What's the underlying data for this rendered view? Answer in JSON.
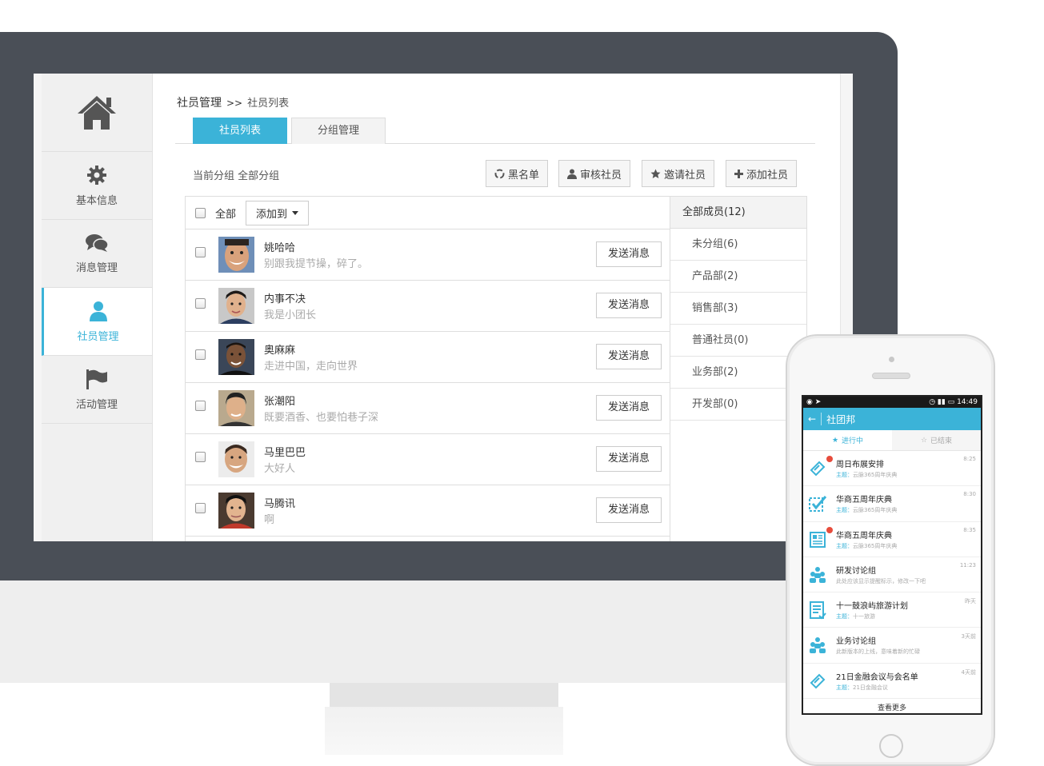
{
  "sidebar": {
    "items": [
      {
        "label": "基本信息",
        "icon": "gear-icon"
      },
      {
        "label": "消息管理",
        "icon": "chat-icon"
      },
      {
        "label": "社员管理",
        "icon": "user-icon",
        "active": true
      },
      {
        "label": "活动管理",
        "icon": "flag-icon"
      }
    ]
  },
  "breadcrumb": {
    "root": "社员管理",
    "sep": ">>",
    "current": "社员列表"
  },
  "tabs": [
    {
      "label": "社员列表",
      "active": true
    },
    {
      "label": "分组管理"
    }
  ],
  "group_info": "当前分组 全部分组",
  "toolbar": {
    "blacklist": "黑名单",
    "review": "审核社员",
    "invite": "邀请社员",
    "add": "添加社员"
  },
  "list": {
    "select_all": "全部",
    "add_to": "添加到",
    "send_label": "发送消息",
    "rows": [
      {
        "name": "姚哈哈",
        "motto": "别跟我提节操，碎了。"
      },
      {
        "name": "内事不决",
        "motto": "我是小团长"
      },
      {
        "name": "奥麻麻",
        "motto": "走进中国，走向世界"
      },
      {
        "name": "张潮阳",
        "motto": "既要酒香、也要怕巷子深"
      },
      {
        "name": "马里巴巴",
        "motto": "大好人"
      },
      {
        "name": "马腾讯",
        "motto": "啊"
      }
    ]
  },
  "groups": {
    "all": "全部成员(12)",
    "items": [
      "未分组(6)",
      "产品部(2)",
      "销售部(3)",
      "普通社员(0)",
      "业务部(2)",
      "开发部(0)"
    ]
  },
  "phone": {
    "status_time": "14:49",
    "app_title": "社团邦",
    "tabs": [
      "进行中",
      "已结束"
    ],
    "items": [
      {
        "title": "周日布展安排",
        "sub_label": "主题：",
        "sub": "云脉365周年庆典",
        "time": "8:25",
        "icon": "doc-pin-icon",
        "dot": true
      },
      {
        "title": "华商五周年庆典",
        "sub_label": "主题：",
        "sub": "云脉365周年庆典",
        "time": "8:30",
        "icon": "checkbox-icon",
        "dot": false
      },
      {
        "title": "华商五周年庆典",
        "sub_label": "主题：",
        "sub": "云脉365周年庆典",
        "time": "8:35",
        "icon": "newspaper-icon",
        "dot": true
      },
      {
        "title": "研发讨论组",
        "sub_label": "",
        "sub": "此处应该显示提醒标示，修改一下吧",
        "time": "11:23",
        "icon": "group-icon",
        "dot": false
      },
      {
        "title": "十一鼓浪屿旅游计划",
        "sub_label": "主题：",
        "sub": "十一旅游",
        "time": "昨天",
        "icon": "list-icon",
        "dot": false
      },
      {
        "title": "业务讨论组",
        "sub_label": "",
        "sub": "此新版本的上线，意味着新的忙碌",
        "time": "3天前",
        "icon": "group-icon",
        "dot": false
      },
      {
        "title": "21日金融会议与会名单",
        "sub_label": "主题：",
        "sub": "21日金融会议",
        "time": "4天前",
        "icon": "doc-pin-icon",
        "dot": false
      }
    ],
    "more": "查看更多"
  }
}
